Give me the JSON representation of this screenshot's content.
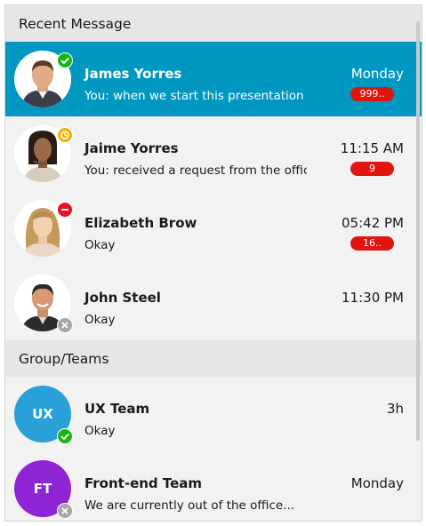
{
  "sections": {
    "recent": {
      "title": "Recent Message"
    },
    "groups": {
      "title": "Group/Teams"
    }
  },
  "recent_messages": [
    {
      "name": "James Yorres",
      "message": "You: when we start this presentation",
      "time": "Monday",
      "badge": "999..",
      "status": "online",
      "avatar_icon": "person-photo-1"
    },
    {
      "name": "Jaime Yorres",
      "message": "You: received a request from the office...",
      "time": "11:15 AM",
      "badge": "9",
      "status": "away",
      "avatar_icon": "person-photo-2"
    },
    {
      "name": "Elizabeth Brow",
      "message": "Okay",
      "time": "05:42 PM",
      "badge": "16..",
      "status": "busy",
      "avatar_icon": "person-photo-3"
    },
    {
      "name": "John Steel",
      "message": "Okay",
      "time": "11:30 PM",
      "badge": "",
      "status": "offline",
      "avatar_icon": "person-photo-4"
    }
  ],
  "groups": [
    {
      "initials": "UX",
      "name": "UX Team",
      "message": "Okay",
      "time": "3h",
      "status": "online",
      "color": "#29a0d8"
    },
    {
      "initials": "FT",
      "name": "Front-end Team",
      "message": "We are currently out of the office...",
      "time": "Monday",
      "status": "offline",
      "color": "#8e24d4"
    }
  ],
  "colors": {
    "accent": "#0097c0",
    "badge": "#e0150f",
    "online": "#14b814",
    "away": "#f0b400",
    "busy": "#e81123",
    "offline": "#a6a6a6"
  }
}
